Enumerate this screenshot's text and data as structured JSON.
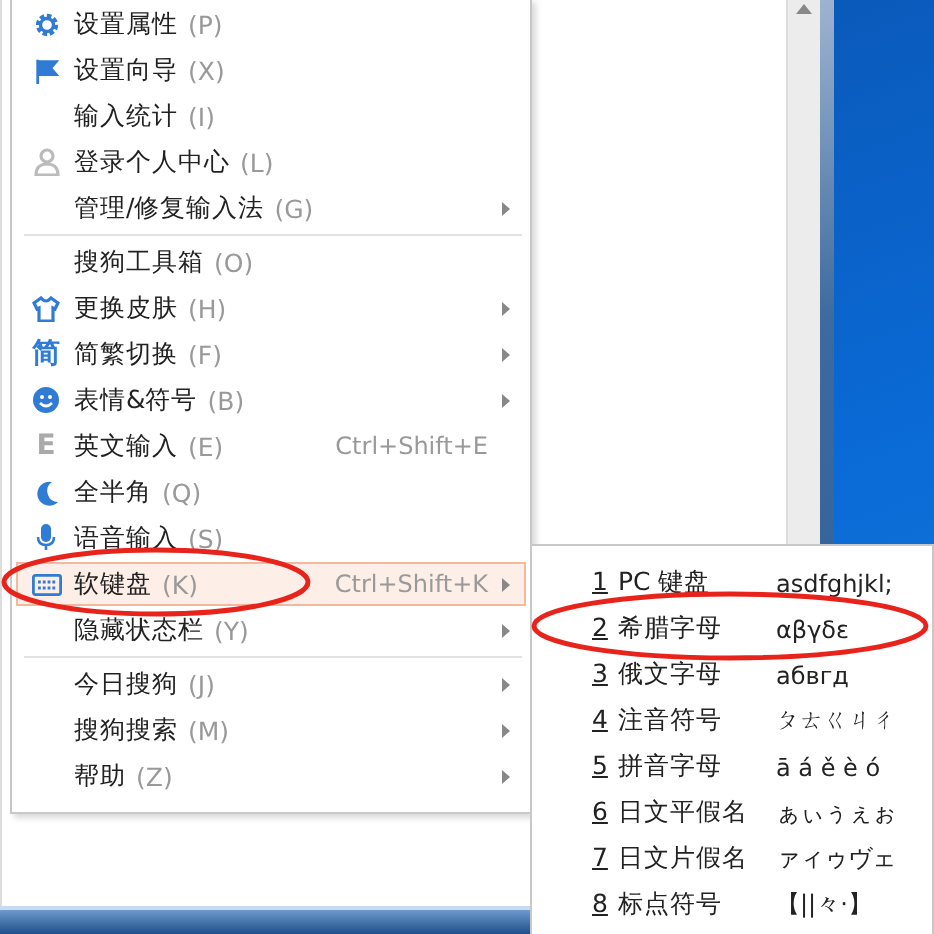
{
  "menu": {
    "items": [
      {
        "kind": "item",
        "label": "设置属性",
        "key": "(P)",
        "submenu": false,
        "selected": false
      },
      {
        "kind": "item",
        "label": "设置向导",
        "key": "(X)",
        "submenu": false,
        "selected": false
      },
      {
        "kind": "item",
        "label": "输入统计",
        "key": "(I)",
        "submenu": false,
        "selected": false
      },
      {
        "kind": "item",
        "label": "登录个人中心",
        "key": "(L)",
        "submenu": false,
        "selected": false
      },
      {
        "kind": "item",
        "label": "管理/修复输入法",
        "key": "(G)",
        "submenu": true,
        "selected": false
      },
      {
        "kind": "separator"
      },
      {
        "kind": "item",
        "label": "搜狗工具箱",
        "key": "(O)",
        "submenu": false,
        "selected": false
      },
      {
        "kind": "item",
        "label": "更换皮肤",
        "key": "(H)",
        "submenu": true,
        "selected": false
      },
      {
        "kind": "item",
        "glyph": "简",
        "label": "简繁切换",
        "key": "(F)",
        "submenu": true,
        "selected": false
      },
      {
        "kind": "item",
        "label": "表情&符号",
        "key": "(B)",
        "submenu": true,
        "selected": false
      },
      {
        "kind": "item",
        "glyph": "E",
        "label": "英文输入",
        "key": "(E)",
        "shortcut": "Ctrl+Shift+E",
        "submenu": false,
        "selected": false
      },
      {
        "kind": "item",
        "label": "全半角",
        "key": "(Q)",
        "submenu": false,
        "selected": false
      },
      {
        "kind": "item",
        "label": "语音输入",
        "key": "(S)",
        "submenu": false,
        "selected": false
      },
      {
        "kind": "item",
        "label": "软键盘",
        "key": "(K)",
        "shortcut": "Ctrl+Shift+K",
        "submenu": true,
        "selected": true
      },
      {
        "kind": "item",
        "label": "隐藏状态栏",
        "key": "(Y)",
        "submenu": true,
        "selected": false
      },
      {
        "kind": "separator"
      },
      {
        "kind": "item",
        "label": "今日搜狗",
        "key": "(J)",
        "submenu": true,
        "selected": false
      },
      {
        "kind": "item",
        "label": "搜狗搜索",
        "key": "(M)",
        "submenu": true,
        "selected": false
      },
      {
        "kind": "item",
        "label": "帮助",
        "key": "(Z)",
        "submenu": true,
        "selected": false
      }
    ]
  },
  "submenu": {
    "items": [
      {
        "number": "1",
        "label": "PC 键盘",
        "sample": "asdfghjkl;"
      },
      {
        "number": "2",
        "label": "希腊字母",
        "sample": "αβγδε"
      },
      {
        "number": "3",
        "label": "俄文字母",
        "sample": "абвгд"
      },
      {
        "number": "4",
        "label": "注音符号",
        "sample": "ㄆㄊㄍㄐㄔ"
      },
      {
        "number": "5",
        "label": "拼音字母",
        "sample": "ā á ě è ó"
      },
      {
        "number": "6",
        "label": "日文平假名",
        "sample": "ぁぃぅぇぉ"
      },
      {
        "number": "7",
        "label": "日文片假名",
        "sample": "ァィゥヴェ"
      },
      {
        "number": "8",
        "label": "标点符号",
        "sample": "【||々·】"
      }
    ]
  }
}
